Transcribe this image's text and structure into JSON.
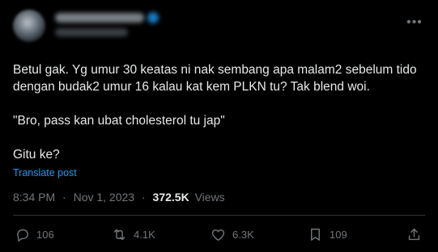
{
  "post": {
    "body": {
      "line1": "Betul gak. Yg umur 30 keatas ni nak sembang apa malam2 sebelum tido",
      "line2": "dengan budak2 umur 16 kalau kat kem PLKN tu? Tak blend woi.",
      "quote": "\"Bro, pass kan ubat cholesterol tu jap\"",
      "closing": "Gitu ke?"
    },
    "translate_label": "Translate post",
    "meta": {
      "time": "8:34 PM",
      "separator": "·",
      "date": "Nov 1, 2023",
      "views_count": "372.5K",
      "views_label": "Views"
    },
    "more_icon": "more-horizontal-icon"
  },
  "actions": {
    "replies": "106",
    "reposts": "4.1K",
    "likes": "6.3K",
    "bookmarks": "109"
  },
  "colors": {
    "background": "#000000",
    "text": "#e7e9ea",
    "muted": "#71767b",
    "link": "#1d9bf0",
    "divider": "#2f3336"
  }
}
